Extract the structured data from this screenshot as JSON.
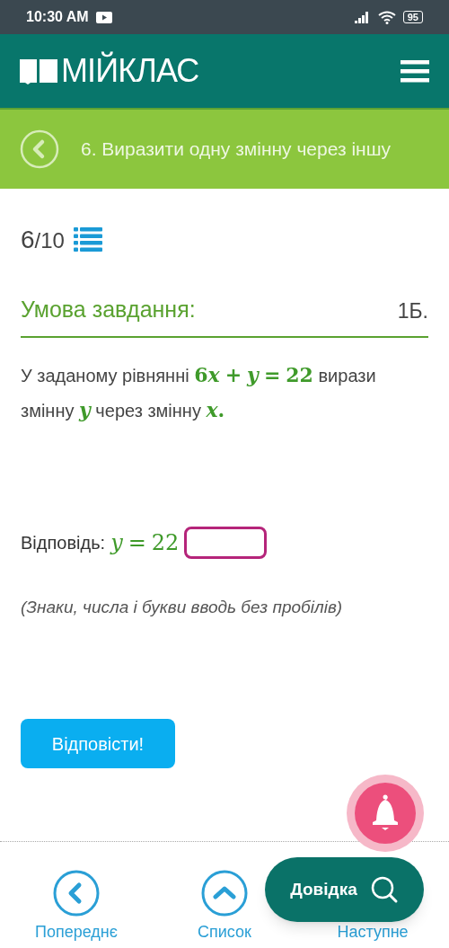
{
  "status_bar": {
    "time": "10:30 AM",
    "battery": "95"
  },
  "header": {
    "logo": "МІЙКЛАС"
  },
  "topic_bar": {
    "title": "6. Виразити одну змінну через іншу"
  },
  "progress": {
    "counter_current": "6",
    "counter_total": "/10"
  },
  "task": {
    "heading": "Умова завдання:",
    "points": "1Б.",
    "problem": [
      {
        "kind": "text",
        "text": "У заданому рівнянні"
      },
      {
        "kind": "math",
        "tokens": [
          {
            "kind": "num",
            "text": "6"
          },
          {
            "kind": "var",
            "text": "x"
          },
          {
            "kind": "op",
            "text": "+"
          },
          {
            "kind": "var",
            "text": "y"
          },
          {
            "kind": "op",
            "text": "="
          },
          {
            "kind": "num",
            "text": "22"
          }
        ]
      },
      {
        "kind": "text",
        "text": "вирази змінну"
      },
      {
        "kind": "math",
        "tokens": [
          {
            "kind": "var",
            "text": "y"
          }
        ]
      },
      {
        "kind": "text",
        "text": "через змінну"
      },
      {
        "kind": "math",
        "tokens": [
          {
            "kind": "var",
            "text": "x"
          },
          {
            "kind": "num",
            "text": "."
          }
        ]
      }
    ],
    "answer_label": "Відповідь:",
    "answer_math": [
      {
        "kind": "var",
        "text": "y"
      },
      {
        "kind": "op",
        "text": "="
      },
      {
        "kind": "num",
        "text": "22"
      }
    ],
    "hint": "(Знаки, числа і букви вводь без пробілів)",
    "submit": "Відповісти!"
  },
  "bottom_nav": [
    {
      "kind": "prev",
      "label": "Попереднє"
    },
    {
      "kind": "list",
      "label": "Список"
    },
    {
      "kind": "next",
      "label": "Наступне"
    }
  ],
  "help_button": "Довідка"
}
